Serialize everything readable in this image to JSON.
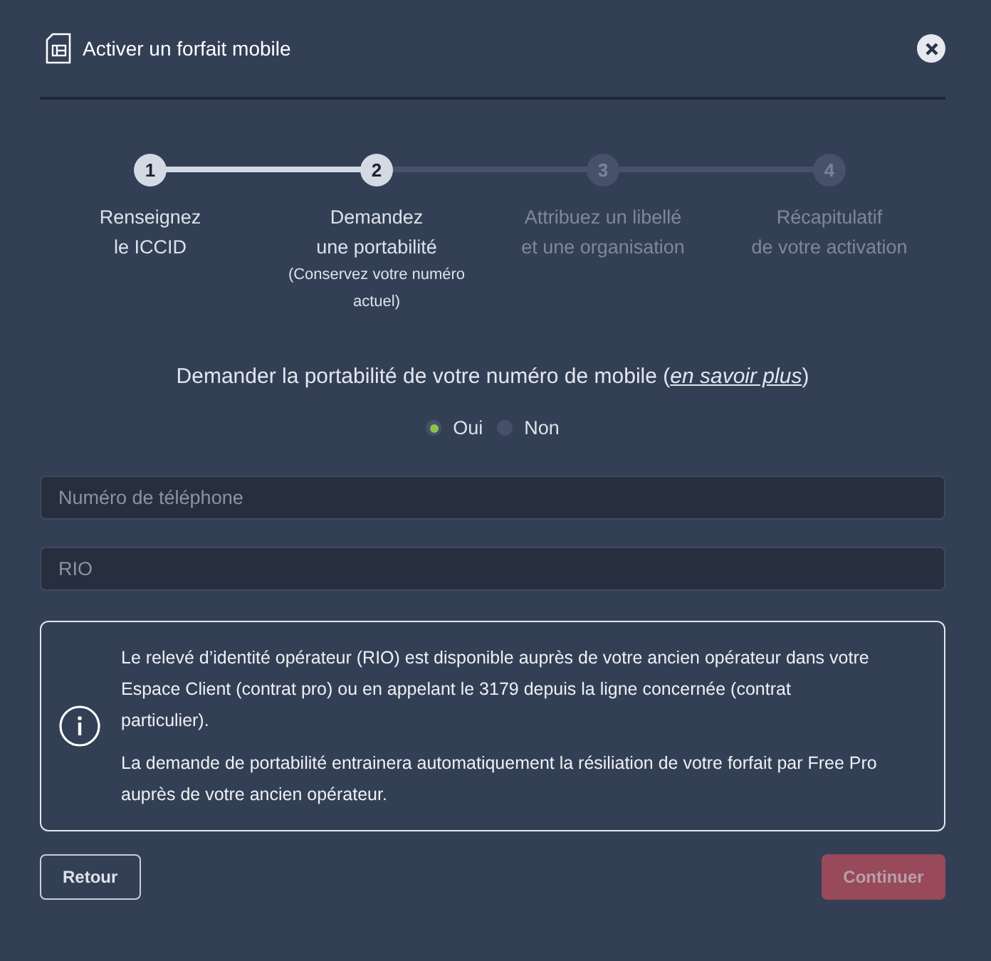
{
  "dialog": {
    "title": "Activer un forfait mobile"
  },
  "steps": [
    {
      "number": "1",
      "label": [
        "Renseignez",
        "le ICCID"
      ],
      "reached": true
    },
    {
      "number": "2",
      "label": [
        "Demandez",
        "une portabilité"
      ],
      "note": "(Conservez votre numéro actuel)",
      "reached": true
    },
    {
      "number": "3",
      "label": [
        "Attribuez un libellé",
        "et une organisation"
      ],
      "reached": false
    },
    {
      "number": "4",
      "label": [
        "Récapitulatif",
        "de votre activation"
      ],
      "reached": false
    }
  ],
  "question": {
    "text_before": "Demander la portabilité de votre numéro de mobile (",
    "link": "en savoir plus",
    "text_after": ")"
  },
  "options": [
    {
      "label": "Oui",
      "selected": true
    },
    {
      "label": "Non",
      "selected": false
    }
  ],
  "fields": [
    {
      "placeholder": "Numéro de téléphone"
    },
    {
      "placeholder": "RIO"
    }
  ],
  "info": [
    "Le relevé d’identité opérateur (RIO) est disponible auprès de votre ancien opérateur dans votre Espace Client (contrat pro) ou en appelant le 3179 depuis la ligne concernée (contrat particulier).",
    "La demande de portabilité entrainera automatiquement la résiliation de votre forfait par Free Pro auprès de votre ancien opérateur."
  ],
  "buttons": {
    "back": {
      "label": "Retour"
    },
    "next": {
      "label": "Continuer",
      "disabled": true
    }
  }
}
